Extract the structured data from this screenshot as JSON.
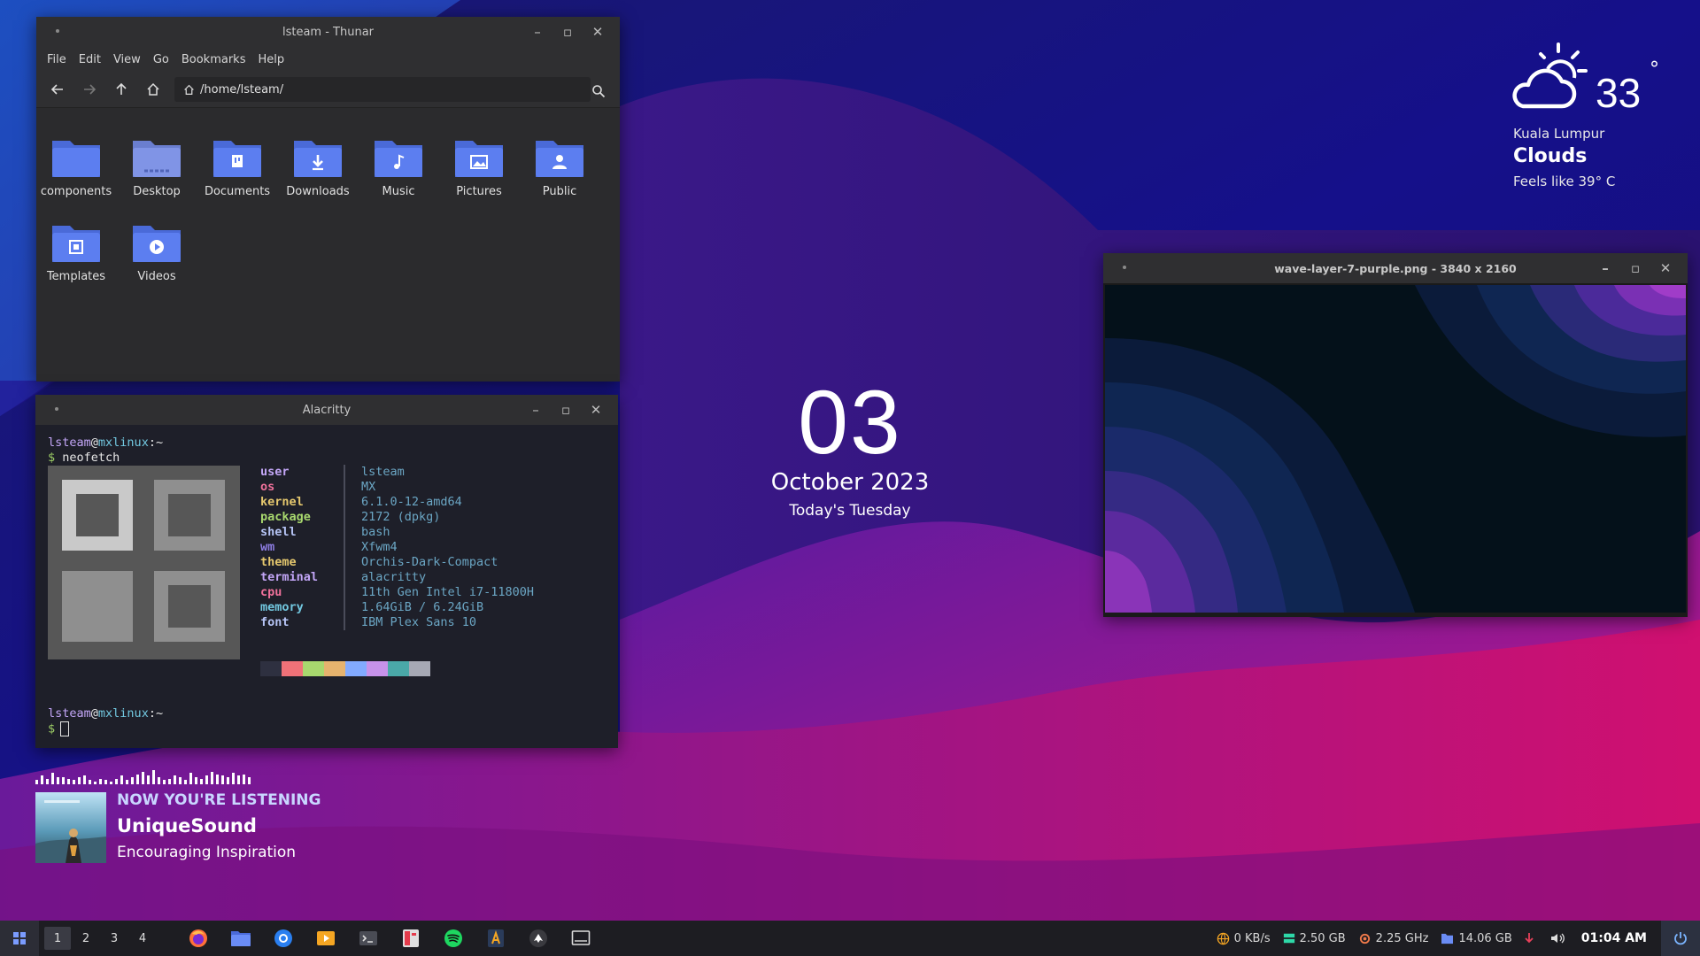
{
  "thunar": {
    "title": "lsteam - Thunar",
    "menu": [
      "File",
      "Edit",
      "View",
      "Go",
      "Bookmarks",
      "Help"
    ],
    "path": "/home/lsteam/",
    "files": [
      {
        "name": "components",
        "icon": "folder-icon"
      },
      {
        "name": "Desktop",
        "icon": "desktop-folder-icon"
      },
      {
        "name": "Documents",
        "icon": "documents-folder-icon"
      },
      {
        "name": "Downloads",
        "icon": "downloads-folder-icon"
      },
      {
        "name": "Music",
        "icon": "music-folder-icon"
      },
      {
        "name": "Pictures",
        "icon": "pictures-folder-icon"
      },
      {
        "name": "Public",
        "icon": "public-folder-icon"
      },
      {
        "name": "Templates",
        "icon": "templates-folder-icon"
      },
      {
        "name": "Videos",
        "icon": "videos-folder-icon"
      }
    ]
  },
  "terminal": {
    "title": "Alacritty",
    "user": "lsteam",
    "at": "@",
    "host": "mxlinux",
    "cwd": ":~",
    "prompt": "$",
    "command": "neofetch",
    "info": [
      {
        "key": "user",
        "value": "lsteam",
        "color": "#c3a6f7"
      },
      {
        "key": "os",
        "value": "MX",
        "color": "#f0719b"
      },
      {
        "key": "kernel",
        "value": "6.1.0-12-amd64",
        "color": "#e6c86e"
      },
      {
        "key": "package",
        "value": "2172 (dpkg)",
        "color": "#a8d86e"
      },
      {
        "key": "shell",
        "value": "bash",
        "color": "#b6c4f5"
      },
      {
        "key": "wm",
        "value": "Xfwm4",
        "color": "#8c7ce0"
      },
      {
        "key": "theme",
        "value": "Orchis-Dark-Compact",
        "color": "#e6c86e"
      },
      {
        "key": "terminal",
        "value": "alacritty",
        "color": "#c3a6f7"
      },
      {
        "key": "cpu",
        "value": "11th Gen Intel i7-11800H",
        "color": "#f0719b"
      },
      {
        "key": "memory",
        "value": "1.64GiB / 6.24GiB",
        "color": "#72c8e0"
      },
      {
        "key": "font",
        "value": "IBM Plex Sans 10",
        "color": "#b6c4f5"
      }
    ],
    "palette": [
      "#2e3040",
      "#f07178",
      "#a8d86e",
      "#e6b36e",
      "#82aaff",
      "#c792ea",
      "#4aa8a8",
      "#a6a8b4"
    ]
  },
  "viewer": {
    "filename": "wave-layer-7-purple.png",
    "dims": "- 3840 x 2160"
  },
  "clock": {
    "day": "03",
    "month_year": "October 2023",
    "weekday": "Today's Tuesday"
  },
  "weather": {
    "icon": "partly-cloudy-icon",
    "temp": "33",
    "degree": "°",
    "city": "Kuala Lumpur",
    "condition": "Clouds",
    "feels_like": "Feels like 39° C"
  },
  "player": {
    "label": "NOW YOU'RE LISTENING",
    "song": "UniqueSound",
    "artist": "Encouraging Inspiration",
    "visualizer_levels": [
      0.3,
      0.6,
      0.4,
      0.8,
      0.5,
      0.5,
      0.4,
      0.3,
      0.5,
      0.6,
      0.3,
      0.2,
      0.4,
      0.3,
      0.2,
      0.4,
      0.6,
      0.3,
      0.5,
      0.7,
      0.9,
      0.6,
      1.0,
      0.5,
      0.3,
      0.4,
      0.6,
      0.5,
      0.3,
      0.8,
      0.5,
      0.4,
      0.6,
      0.9,
      0.7,
      0.6,
      0.5,
      0.8,
      0.6,
      0.7,
      0.5
    ]
  },
  "taskbar": {
    "workspaces": [
      "1",
      "2",
      "3",
      "4"
    ],
    "apps": [
      "firefox-icon",
      "files-icon",
      "browser-icon",
      "media-player-icon",
      "terminal-icon",
      "app-icon",
      "spotify-icon",
      "text-editor-icon",
      "inkscape-icon",
      "display-icon"
    ],
    "net": "0 KB/s",
    "ram": "2.50 GB",
    "cpu": "2.25 GHz",
    "disk": "14.06 GB",
    "time": "01:04 AM"
  }
}
